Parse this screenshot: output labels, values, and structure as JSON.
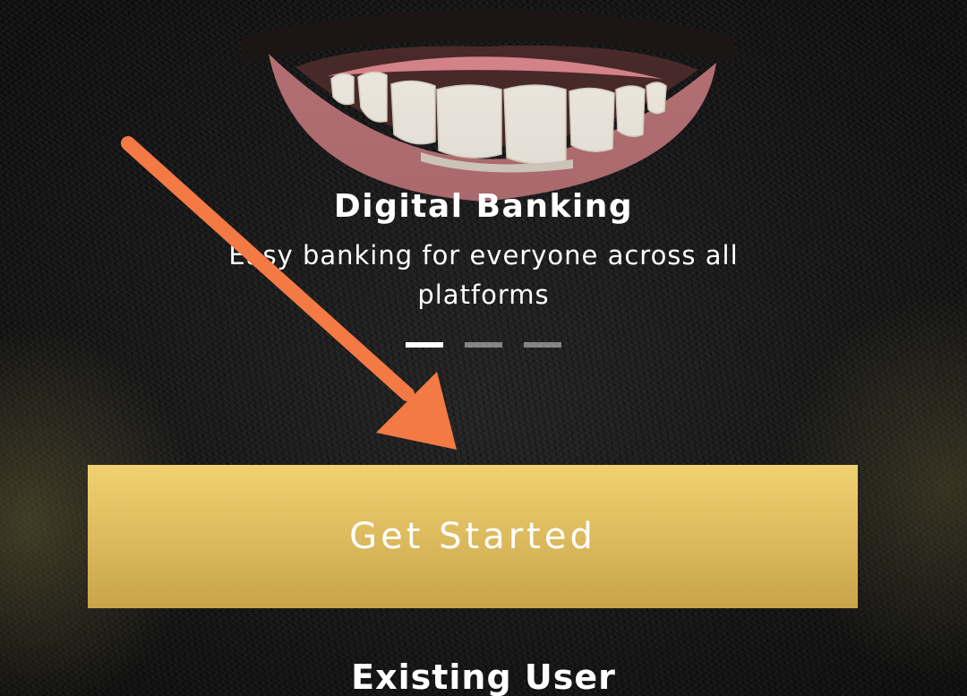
{
  "hero": {
    "title": "Digital Banking",
    "subtitle": "Easy banking for everyone across all platforms"
  },
  "carousel": {
    "total_slides": 3,
    "active_index": 0
  },
  "actions": {
    "primary_label": "Get Started",
    "secondary_label": "Existing User"
  },
  "colors": {
    "button_gold_top": "#f0d171",
    "button_gold_bottom": "#c9a44a",
    "annotation_arrow": "#f47a45",
    "text": "#ffffff"
  },
  "icons": {
    "annotation": "arrow-down-right-icon"
  }
}
